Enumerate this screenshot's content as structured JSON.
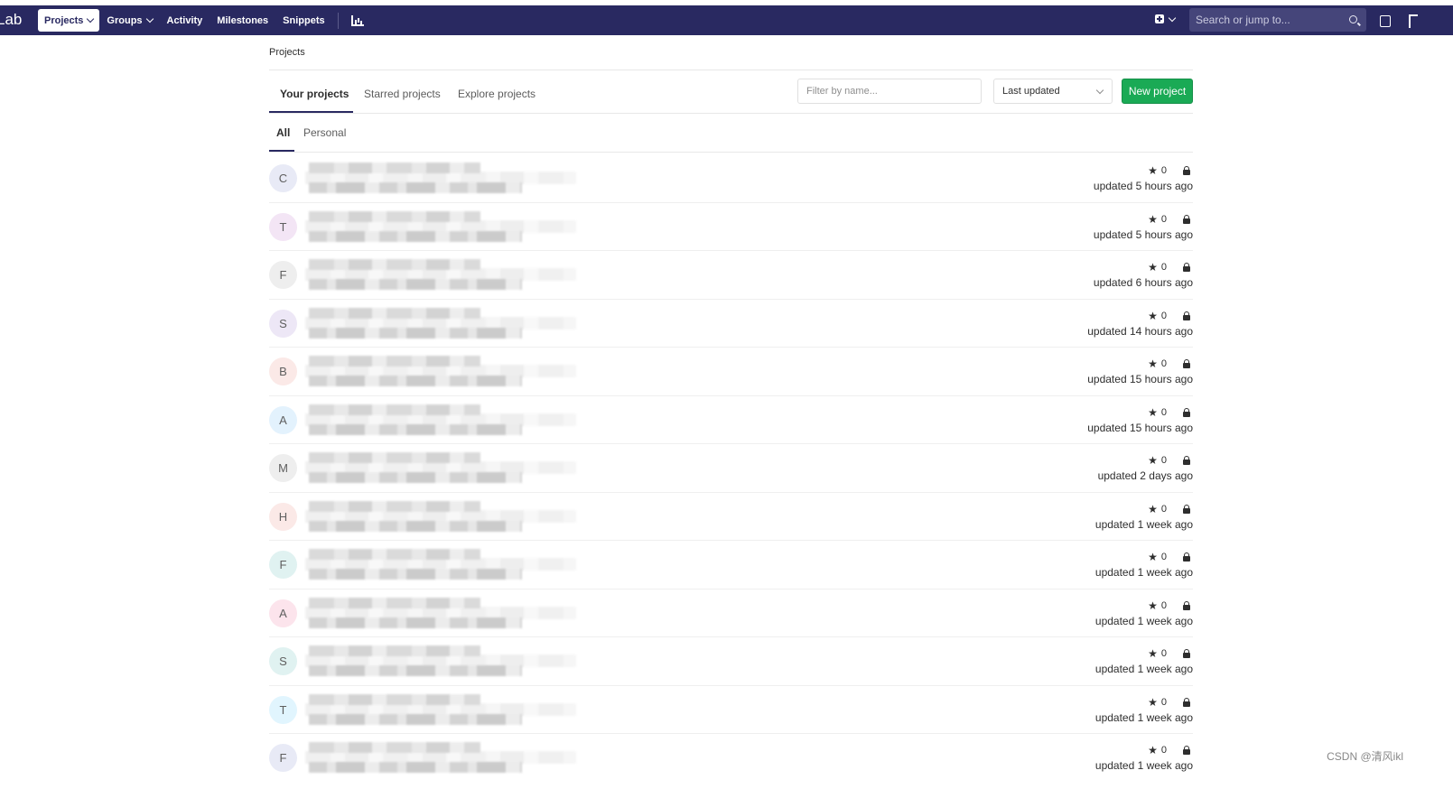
{
  "header": {
    "brand": "Lab",
    "nav": [
      {
        "label": "Projects",
        "dropdown": true,
        "active": true
      },
      {
        "label": "Groups",
        "dropdown": true,
        "active": false
      },
      {
        "label": "Activity",
        "dropdown": false,
        "active": false
      },
      {
        "label": "Milestones",
        "dropdown": false,
        "active": false
      },
      {
        "label": "Snippets",
        "dropdown": false,
        "active": false
      }
    ],
    "search_placeholder": "Search or jump to...",
    "icons": [
      "chart-icon",
      "plus-icon",
      "search-icon",
      "todo-icon",
      "merge-request-icon"
    ],
    "colors": {
      "navbar": "#292961",
      "primary_button": "#1aaa55"
    }
  },
  "breadcrumb": "Projects",
  "tabs": [
    {
      "label": "Your projects",
      "active": true
    },
    {
      "label": "Starred projects",
      "active": false
    },
    {
      "label": "Explore projects",
      "active": false
    }
  ],
  "filter_placeholder": "Filter by name...",
  "sort_selected": "Last updated",
  "new_project_label": "New project",
  "subtabs": [
    {
      "label": "All",
      "active": true
    },
    {
      "label": "Personal",
      "active": false
    }
  ],
  "projects": [
    {
      "initial": "C",
      "avatar_color": "#e8eaf6",
      "stars": "0",
      "updated": "updated 5 hours ago"
    },
    {
      "initial": "T",
      "avatar_color": "#f3e5f5",
      "stars": "0",
      "updated": "updated 5 hours ago"
    },
    {
      "initial": "F",
      "avatar_color": "#eeeeee",
      "stars": "0",
      "updated": "updated 6 hours ago"
    },
    {
      "initial": "S",
      "avatar_color": "#ede7f6",
      "stars": "0",
      "updated": "updated 14 hours ago"
    },
    {
      "initial": "B",
      "avatar_color": "#fbe9e7",
      "stars": "0",
      "updated": "updated 15 hours ago"
    },
    {
      "initial": "A",
      "avatar_color": "#e3f2fd",
      "stars": "0",
      "updated": "updated 15 hours ago"
    },
    {
      "initial": "M",
      "avatar_color": "#eeeeee",
      "stars": "0",
      "updated": "updated 2 days ago"
    },
    {
      "initial": "H",
      "avatar_color": "#fbe9e7",
      "stars": "0",
      "updated": "updated 1 week ago"
    },
    {
      "initial": "F",
      "avatar_color": "#e0f2f1",
      "stars": "0",
      "updated": "updated 1 week ago"
    },
    {
      "initial": "A",
      "avatar_color": "#fce4ec",
      "stars": "0",
      "updated": "updated 1 week ago"
    },
    {
      "initial": "S",
      "avatar_color": "#e0f2f1",
      "stars": "0",
      "updated": "updated 1 week ago"
    },
    {
      "initial": "T",
      "avatar_color": "#e1f5fe",
      "stars": "0",
      "updated": "updated 1 week ago"
    },
    {
      "initial": "F",
      "avatar_color": "#e8eaf6",
      "stars": "0",
      "updated": "updated 1 week ago"
    }
  ],
  "watermark": "CSDN @清风ikl"
}
